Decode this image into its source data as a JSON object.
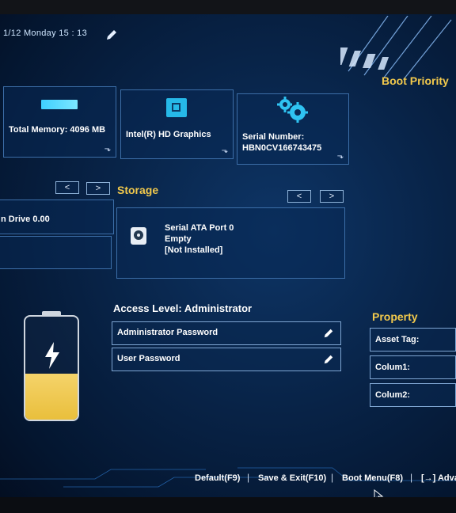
{
  "header": {
    "datetime": "1/12  Monday  15 : 13",
    "boot_priority": "Boot Priority"
  },
  "info_cards": {
    "memory": "Total Memory: 4096 MB",
    "graphics": "Intel(R) HD Graphics",
    "serial_line1": "Serial Number:",
    "serial_line2": "HBN0CV166743475"
  },
  "drive": {
    "label": "n Drive 0.00"
  },
  "storage": {
    "title": "Storage",
    "port": "Serial ATA Port 0",
    "status": "Empty",
    "state": "[Not Installed]"
  },
  "nav": {
    "prev": "<",
    "next": ">"
  },
  "access": {
    "title": "Access Level: Administrator",
    "admin_password": "Administrator Password",
    "user_password": "User Password"
  },
  "property": {
    "title": "Property",
    "asset_tag": "Asset Tag:",
    "colum1": "Colum1:",
    "colum2": "Colum2:"
  },
  "battery": {
    "level_percent": 45
  },
  "footer": {
    "default": "Default(F9)",
    "save_exit": "Save & Exit(F10)",
    "boot_menu": "Boot Menu(F8)",
    "advanced": "[→] Adva",
    "separator": "|"
  },
  "colors": {
    "accent_yellow": "#f2c94c",
    "border_blue": "#3c6ea8",
    "background": "#082347"
  }
}
